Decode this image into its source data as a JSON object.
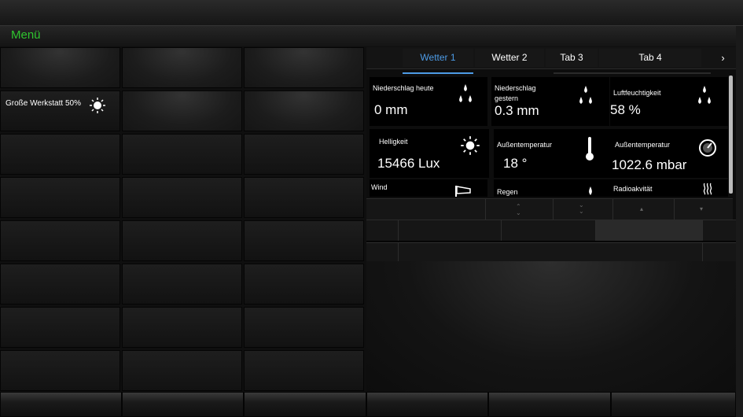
{
  "menu": {
    "label": "Menü"
  },
  "left_grid": {
    "cell_label": "Große Werkstatt 50%",
    "icon": "sun-icon"
  },
  "tabs": [
    {
      "label": "Wetter 1",
      "active": true
    },
    {
      "label": "Wetter 2",
      "active": false
    },
    {
      "label": "Tab 3",
      "active": false
    },
    {
      "label": "Tab 4",
      "active": false
    }
  ],
  "tab_next": "›",
  "weather": [
    {
      "title": "Niederschlag heute",
      "value": "0 mm",
      "icon": "raindrops-icon"
    },
    {
      "title": "Niederschlag gestern",
      "value": "0.3 mm",
      "icon": "raindrops-icon"
    },
    {
      "title": "Luftfeuchtigkeit",
      "value": "58 %",
      "icon": "raindrops-icon"
    },
    {
      "title": "Helligkeit",
      "value": "15466 Lux",
      "icon": "sun-icon"
    },
    {
      "title": "Außentemperatur",
      "value": "18 °",
      "icon": "thermometer-icon"
    },
    {
      "title": "Außentemperatur",
      "value": "1022.6 mbar",
      "icon": "barometer-icon"
    },
    {
      "title": "Wind",
      "value": "",
      "icon": "wind-icon"
    },
    {
      "title": "Regen",
      "value": "",
      "icon": "raindrop-icon"
    },
    {
      "title": "Radioakvität",
      "value": "",
      "icon": "radiation-icon"
    }
  ],
  "colors": {
    "accent": "#4d9be6",
    "menu": "#2fc42f",
    "background": "#0f0f0f"
  }
}
